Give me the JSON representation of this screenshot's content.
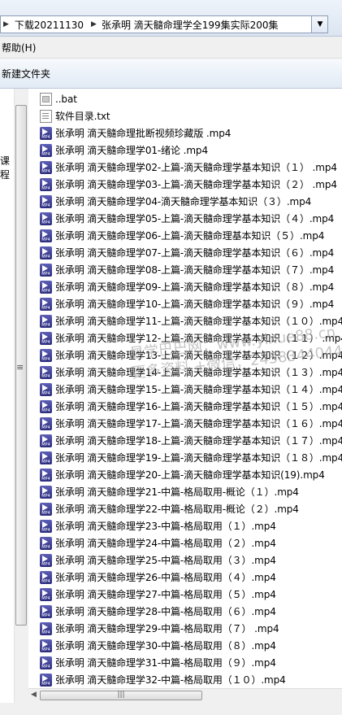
{
  "address": {
    "segments": [
      "下载20211130",
      "张承明 滴天髓命理学全199集实际200集"
    ]
  },
  "menubar": {
    "help_label": "帮助(H)"
  },
  "toolbar": {
    "new_folder_label": "新建文件夹"
  },
  "navpane": {
    "fragment": "课程"
  },
  "files": [
    {
      "name": "..bat",
      "type": "bat"
    },
    {
      "name": "软件目录.txt",
      "type": "txt"
    },
    {
      "name": "张承明 滴天髓命理批断视频珍藏版 .mp4",
      "type": "mp4"
    },
    {
      "name": "张承明 滴天髓命理学01-绪论 .mp4",
      "type": "mp4"
    },
    {
      "name": "张承明 滴天髓命理学02-上篇-滴天髓命理学基本知识（１） .mp4",
      "type": "mp4"
    },
    {
      "name": "张承明 滴天髓命理学03-上篇-滴天髓命理学基本知识（２） .mp4",
      "type": "mp4"
    },
    {
      "name": "张承明 滴天髓命理学04-滴天髓命理学基本知识（３）.mp4",
      "type": "mp4"
    },
    {
      "name": "张承明 滴天髓命理学05-上篇-滴天髓命理学基本知识（４）.mp4",
      "type": "mp4"
    },
    {
      "name": "张承明 滴天髓命理学06-上篇-滴天髓命理基本知识（５）.mp4",
      "type": "mp4"
    },
    {
      "name": "张承明 滴天髓命理学07-上篇-滴天髓命理学基本知识（６）.mp4",
      "type": "mp4"
    },
    {
      "name": "张承明 滴天髓命理学08-上篇-滴天髓命理学基本知识（７）.mp4",
      "type": "mp4"
    },
    {
      "name": "张承明 滴天髓命理学09-上篇-滴天髓命理学基本知识（８）.mp4",
      "type": "mp4"
    },
    {
      "name": "张承明 滴天髓命理学10-上篇-滴天髓命理学基本知识（９）.mp4",
      "type": "mp4"
    },
    {
      "name": "张承明 滴天髓命理学11-上篇-滴天髓命理学基本知识（１０）.mp4",
      "type": "mp4"
    },
    {
      "name": "张承明 滴天髓命理学12-上篇-滴天髓命理学基本知识（１１） .mp4",
      "type": "mp4"
    },
    {
      "name": "张承明 滴天髓命理学13-上篇-滴天髓命理学基本知识（１２）.mp4",
      "type": "mp4"
    },
    {
      "name": "张承明 滴天髓命理学14-上篇-滴天髓命理学基本知识（１３）.mp4",
      "type": "mp4"
    },
    {
      "name": "张承明 滴天髓命理学15-上篇-滴天髓命理学基本知识（１４）.mp4",
      "type": "mp4"
    },
    {
      "name": "张承明 滴天髓命理学16-上篇-滴天髓命理学基本知识（１５）.mp4",
      "type": "mp4"
    },
    {
      "name": "张承明 滴天髓命理学17-上篇-滴天髓命理学基本知识（１６）.mp4",
      "type": "mp4"
    },
    {
      "name": "张承明 滴天髓命理学18-上篇-滴天髓命理学基本知识（１７）.mp4",
      "type": "mp4"
    },
    {
      "name": "张承明 滴天髓命理学19-上篇-滴天髓命理学基本知识（１８）.mp4",
      "type": "mp4"
    },
    {
      "name": "张承明 滴天髓命理学20-上篇-滴天髓命理学基本知识(19).mp4",
      "type": "mp4"
    },
    {
      "name": "张承明 滴天髓命理学21-中篇-格局取用-概论（１）.mp4",
      "type": "mp4"
    },
    {
      "name": "张承明 滴天髓命理学22-中篇-格局取用-概论（２）.mp4",
      "type": "mp4"
    },
    {
      "name": "张承明 滴天髓命理学23-中篇-格局取用（１）.mp4",
      "type": "mp4"
    },
    {
      "name": "张承明 滴天髓命理学24-中篇-格局取用（２）.mp4",
      "type": "mp4"
    },
    {
      "name": "张承明 滴天髓命理学25-中篇-格局取用（３）.mp4",
      "type": "mp4"
    },
    {
      "name": "张承明 滴天髓命理学26-中篇-格局取用（４）.mp4",
      "type": "mp4"
    },
    {
      "name": "张承明 滴天髓命理学27-中篇-格局取用（５）.mp4",
      "type": "mp4"
    },
    {
      "name": "张承明 滴天髓命理学28-中篇-格局取用（６）.mp4",
      "type": "mp4"
    },
    {
      "name": "张承明 滴天髓命理学29-中篇-格局取用（７） .mp4",
      "type": "mp4"
    },
    {
      "name": "张承明 滴天髓命理学30-中篇-格局取用（８）.mp4",
      "type": "mp4"
    },
    {
      "name": "张承明 滴天髓命理学31-中篇-格局取用（９）.mp4",
      "type": "mp4"
    },
    {
      "name": "张承明 滴天髓命理学32-中篇-格局取用（１０）.mp4",
      "type": "mp4"
    }
  ],
  "icons": {
    "mp4": "video-file-icon",
    "txt": "text-file-icon",
    "bat": "batch-file-icon",
    "mp4_badge": "MP4"
  },
  "watermark": {
    "line1": "易学巴巴网：www.yixue88.cn",
    "line2": "更多资料 +微信：2458344044"
  },
  "colors": {
    "chrome_bg": "#f0f0f0",
    "address_gradient_top": "#eef3fa",
    "video_icon": "#3a3b8f"
  }
}
